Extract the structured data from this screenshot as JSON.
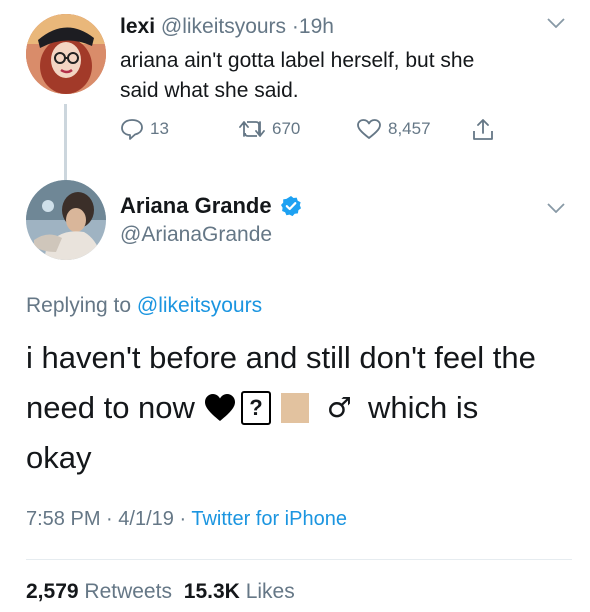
{
  "reply_tweet": {
    "display_name": "lexi",
    "handle": "@likeitsyours",
    "separator": "·",
    "time": "19h",
    "text_line1": "ariana ain't gotta label herself, but she",
    "text_line2": "said what she said.",
    "actions": {
      "replies": "13",
      "retweets": "670",
      "likes": "8,457"
    }
  },
  "main_tweet": {
    "display_name": "Ariana Grande",
    "handle": "@ArianaGrande",
    "replying_prefix": "Replying to",
    "replying_handle": "@likeitsyours",
    "text_line1": "i haven't before and still don't feel the",
    "text_line2_start": "need to now",
    "text_line2_end": "which is",
    "text_line3": "okay",
    "glyph_heart": "🖤",
    "glyph_unknown": "?",
    "glyph_male": "♂",
    "meta": {
      "time": "7:58 PM",
      "dot1": "·",
      "date": "4/1/19",
      "dot2": "·",
      "source": "Twitter for iPhone"
    },
    "stats": {
      "retweets_count": "2,579",
      "retweets_label": "Retweets",
      "likes_count": "15.3K",
      "likes_label": "Likes"
    }
  },
  "colors": {
    "text": "#14171a",
    "secondary": "#657786",
    "link": "#1b95e0",
    "verified": "#1da1f2",
    "thread_line": "#ccd6dd",
    "divider": "#e6ecf0",
    "skin_tone": "#e2c29f"
  },
  "icons": {
    "reply": "reply-icon",
    "retweet": "retweet-icon",
    "like": "heart-icon",
    "share": "share-icon",
    "caret": "chevron-down-icon",
    "verified": "verified-badge-icon"
  }
}
